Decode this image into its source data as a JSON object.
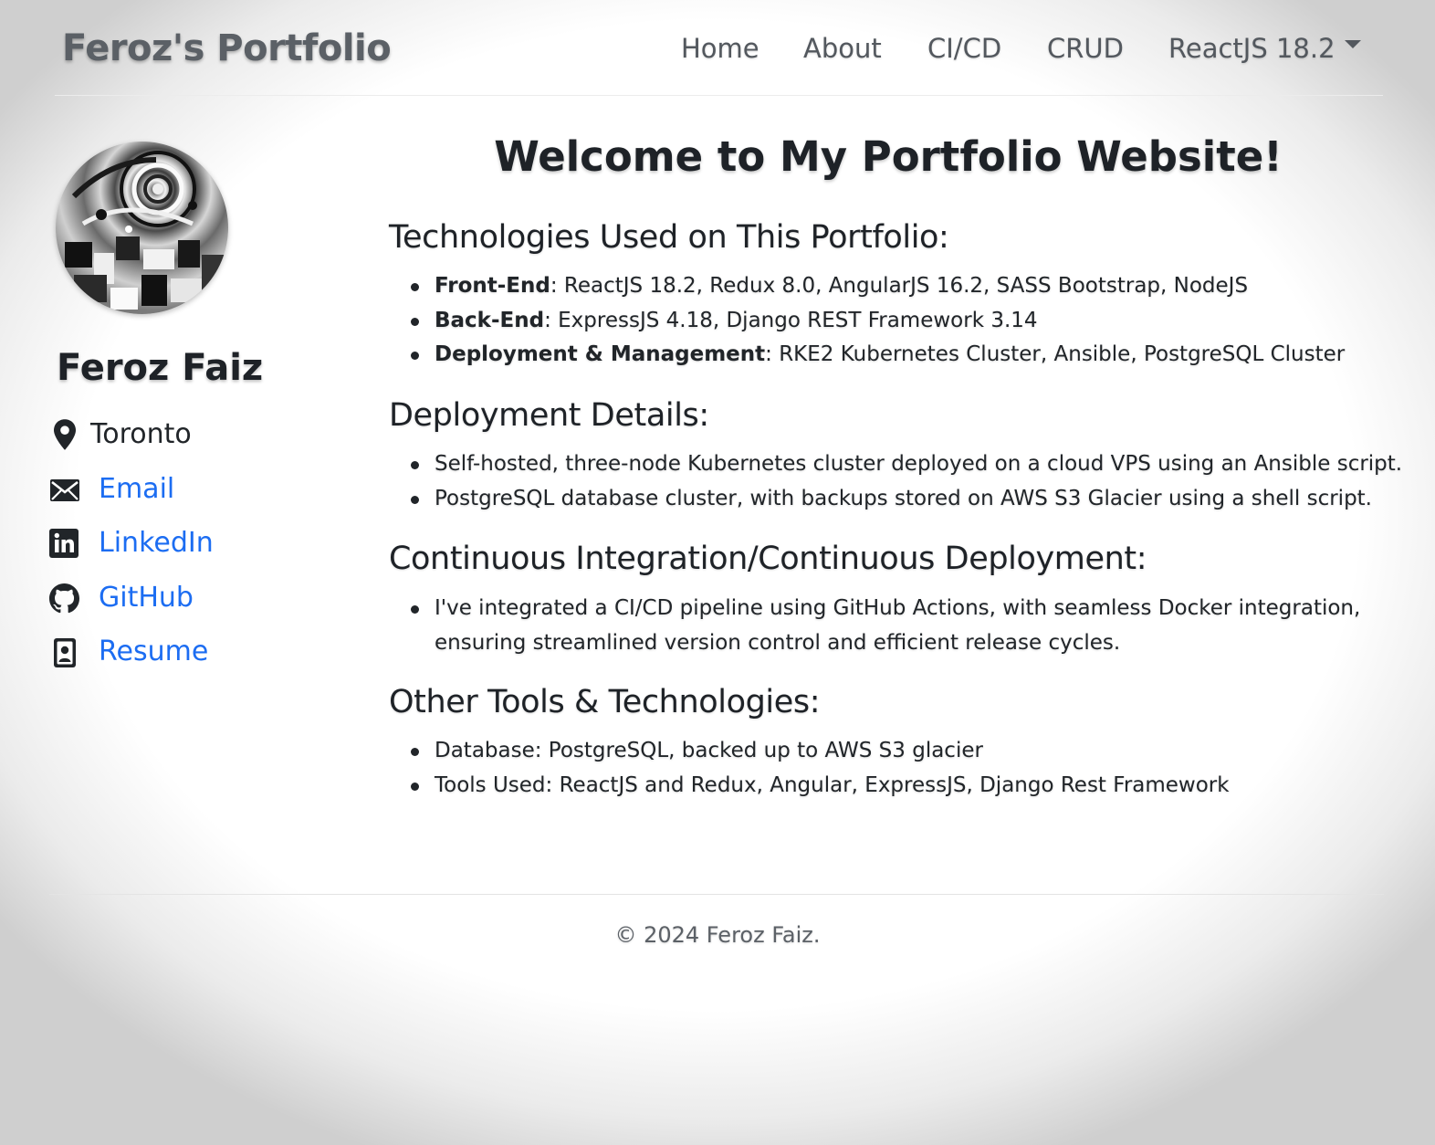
{
  "navbar": {
    "brand": "Feroz's Portfolio",
    "items": [
      {
        "label": "Home"
      },
      {
        "label": "About"
      },
      {
        "label": "CI/CD"
      },
      {
        "label": "CRUD"
      },
      {
        "label": "ReactJS 18.2"
      }
    ],
    "dropdown_icon": "caret-down-icon"
  },
  "sidebar": {
    "avatar_icon": "profile-avatar-image",
    "name": "Feroz Faiz",
    "location": {
      "icon": "map-pin-icon",
      "text": "Toronto"
    },
    "links": [
      {
        "icon": "envelope-icon",
        "label": "Email"
      },
      {
        "icon": "linkedin-icon",
        "label": "LinkedIn"
      },
      {
        "icon": "github-icon",
        "label": "GitHub"
      },
      {
        "icon": "resume-icon",
        "label": "Resume"
      }
    ],
    "link_color": "#1c6df2"
  },
  "main": {
    "title": "Welcome to My Portfolio Website!",
    "sections": [
      {
        "heading": "Technologies Used on This Portfolio:",
        "items": [
          {
            "bold": "Front-End",
            "text": ": ReactJS 18.2, Redux 8.0, AngularJS 16.2, SASS Bootstrap, NodeJS"
          },
          {
            "bold": "Back-End",
            "text": ": ExpressJS 4.18, Django REST Framework 3.14"
          },
          {
            "bold": "Deployment & Management",
            "text": ": RKE2 Kubernetes Cluster, Ansible, PostgreSQL Cluster"
          }
        ]
      },
      {
        "heading": "Deployment Details:",
        "items": [
          {
            "text": "Self-hosted, three-node Kubernetes cluster deployed on a cloud VPS using an Ansible script."
          },
          {
            "text": "PostgreSQL database cluster, with backups stored on AWS S3 Glacier using a shell script."
          }
        ]
      },
      {
        "heading": "Continuous Integration/Continuous Deployment:",
        "items": [
          {
            "text": "I've integrated a CI/CD pipeline using GitHub Actions, with seamless Docker integration,",
            "text2": "ensuring streamlined version control and efficient release cycles."
          }
        ]
      },
      {
        "heading": "Other Tools & Technologies:",
        "items": [
          {
            "text": "Database: PostgreSQL, backed up to AWS S3 glacier"
          },
          {
            "text": "Tools Used: ReactJS and Redux, Angular, ExpressJS, Django Rest Framework"
          }
        ]
      }
    ]
  },
  "footer": {
    "text": "© 2024 Feroz Faiz."
  }
}
